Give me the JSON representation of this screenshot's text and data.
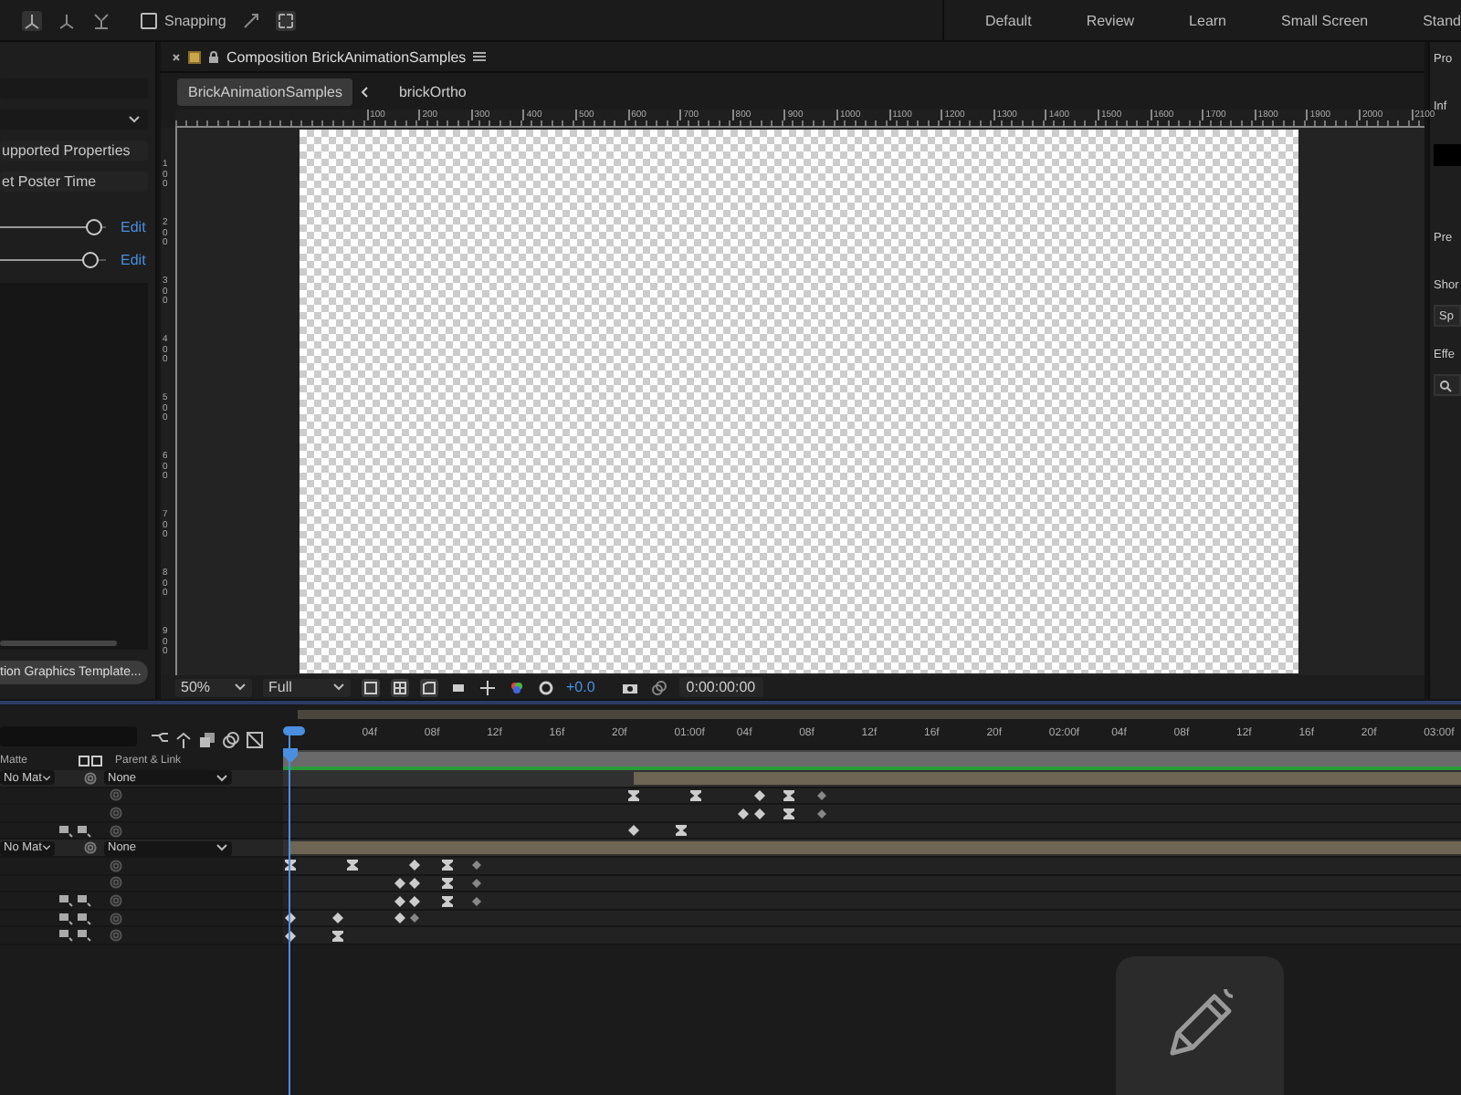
{
  "toolbar": {
    "snapping": {
      "label": "Snapping",
      "checked": false
    },
    "workspaces": [
      {
        "label": "Default",
        "selected": false
      },
      {
        "label": "Review",
        "selected": false
      },
      {
        "label": "Learn",
        "selected": false
      },
      {
        "label": "Small Screen",
        "selected": false
      },
      {
        "label": "Stand",
        "selected": false
      }
    ]
  },
  "left_panel": {
    "items": [
      {
        "kind": "field"
      },
      {
        "kind": "dropdown"
      },
      {
        "kind": "button",
        "label": "upported Properties"
      },
      {
        "kind": "button",
        "label": "et Poster Time"
      },
      {
        "kind": "slider",
        "level": 0.88,
        "link": "Edit"
      },
      {
        "kind": "slider",
        "level": 0.85,
        "link": "Edit"
      }
    ],
    "footer_button": "tion Graphics Template..."
  },
  "composition": {
    "title": "Composition BrickAnimationSamples",
    "breadcrumbs": [
      {
        "label": "BrickAnimationSamples",
        "selected": true
      },
      {
        "label": "brickOrtho",
        "selected": false
      }
    ],
    "ruler_h": [
      "100",
      "200",
      "300",
      "400",
      "500",
      "600",
      "700",
      "800",
      "900",
      "1000",
      "1100",
      "1200",
      "1300",
      "1400",
      "1500",
      "1600",
      "1700",
      "1800",
      "1900",
      "2000",
      "2100"
    ],
    "ruler_v": [
      "100",
      "200",
      "300",
      "400",
      "500",
      "600",
      "700",
      "800",
      "900"
    ],
    "zoom": "50%",
    "resolution": "Full",
    "exposure": "+0.0",
    "timecode": "0:00:00:00"
  },
  "right_panel": {
    "items": [
      {
        "kind": "header",
        "label": "Pro"
      },
      {
        "kind": "header",
        "label": "Inf"
      },
      {
        "kind": "swatch"
      },
      {
        "kind": "header",
        "label": "Pre"
      },
      {
        "kind": "header",
        "label": "Shor"
      },
      {
        "kind": "field",
        "label": "Sp"
      },
      {
        "kind": "header",
        "label": "Effe"
      },
      {
        "kind": "search"
      }
    ]
  },
  "timeline": {
    "columns": [
      "Matte",
      "Parent & Link"
    ],
    "ticks": [
      "04f",
      "08f",
      "12f",
      "16f",
      "20f",
      "01:00f",
      "04f",
      "08f",
      "12f",
      "16f",
      "20f",
      "02:00f",
      "04f",
      "08f",
      "12f",
      "16f",
      "20f",
      "03:00f"
    ],
    "rows": [
      {
        "kind": "layer",
        "matte": "No Mat",
        "parent": "None",
        "level": 0.702
      },
      {
        "kind": "property",
        "switches": false,
        "keys": [
          {
            "level": 0.298,
            "kind": "ease"
          },
          {
            "level": 0.351,
            "kind": "ease"
          },
          {
            "level": 0.404,
            "kind": "diamond"
          },
          {
            "level": 0.43,
            "kind": "ease"
          },
          {
            "level": 0.457,
            "kind": "dim"
          }
        ]
      },
      {
        "kind": "property",
        "switches": false,
        "keys": [
          {
            "level": 0.391,
            "kind": "diamond"
          },
          {
            "level": 0.404,
            "kind": "diamond"
          },
          {
            "level": 0.43,
            "kind": "ease"
          },
          {
            "level": 0.457,
            "kind": "dim"
          }
        ]
      },
      {
        "kind": "property",
        "switches": true,
        "keys": [
          {
            "level": 0.298,
            "kind": "diamond"
          },
          {
            "level": 0.338,
            "kind": "ease"
          }
        ]
      },
      {
        "kind": "layer",
        "matte": "No Mat",
        "parent": "None",
        "level": 0.994
      },
      {
        "kind": "property",
        "switches": false,
        "keys": [
          {
            "level": 0.006,
            "kind": "ease"
          },
          {
            "level": 0.059,
            "kind": "ease"
          },
          {
            "level": 0.112,
            "kind": "diamond"
          },
          {
            "level": 0.139,
            "kind": "ease"
          },
          {
            "level": 0.165,
            "kind": "dim"
          }
        ]
      },
      {
        "kind": "property",
        "switches": false,
        "keys": [
          {
            "level": 0.099,
            "kind": "diamond"
          },
          {
            "level": 0.112,
            "kind": "diamond"
          },
          {
            "level": 0.139,
            "kind": "ease"
          },
          {
            "level": 0.165,
            "kind": "dim"
          }
        ]
      },
      {
        "kind": "property",
        "switches": true,
        "keys": [
          {
            "level": 0.099,
            "kind": "diamond"
          },
          {
            "level": 0.112,
            "kind": "diamond"
          },
          {
            "level": 0.139,
            "kind": "ease"
          },
          {
            "level": 0.165,
            "kind": "dim"
          }
        ]
      },
      {
        "kind": "property",
        "switches": true,
        "keys": [
          {
            "level": 0.006,
            "kind": "diamond"
          },
          {
            "level": 0.046,
            "kind": "diamond"
          },
          {
            "level": 0.099,
            "kind": "diamond"
          },
          {
            "level": 0.112,
            "kind": "dim"
          }
        ]
      },
      {
        "kind": "property",
        "switches": true,
        "keys": [
          {
            "level": 0.006,
            "kind": "diamond"
          },
          {
            "level": 0.046,
            "kind": "ease"
          }
        ]
      }
    ]
  }
}
